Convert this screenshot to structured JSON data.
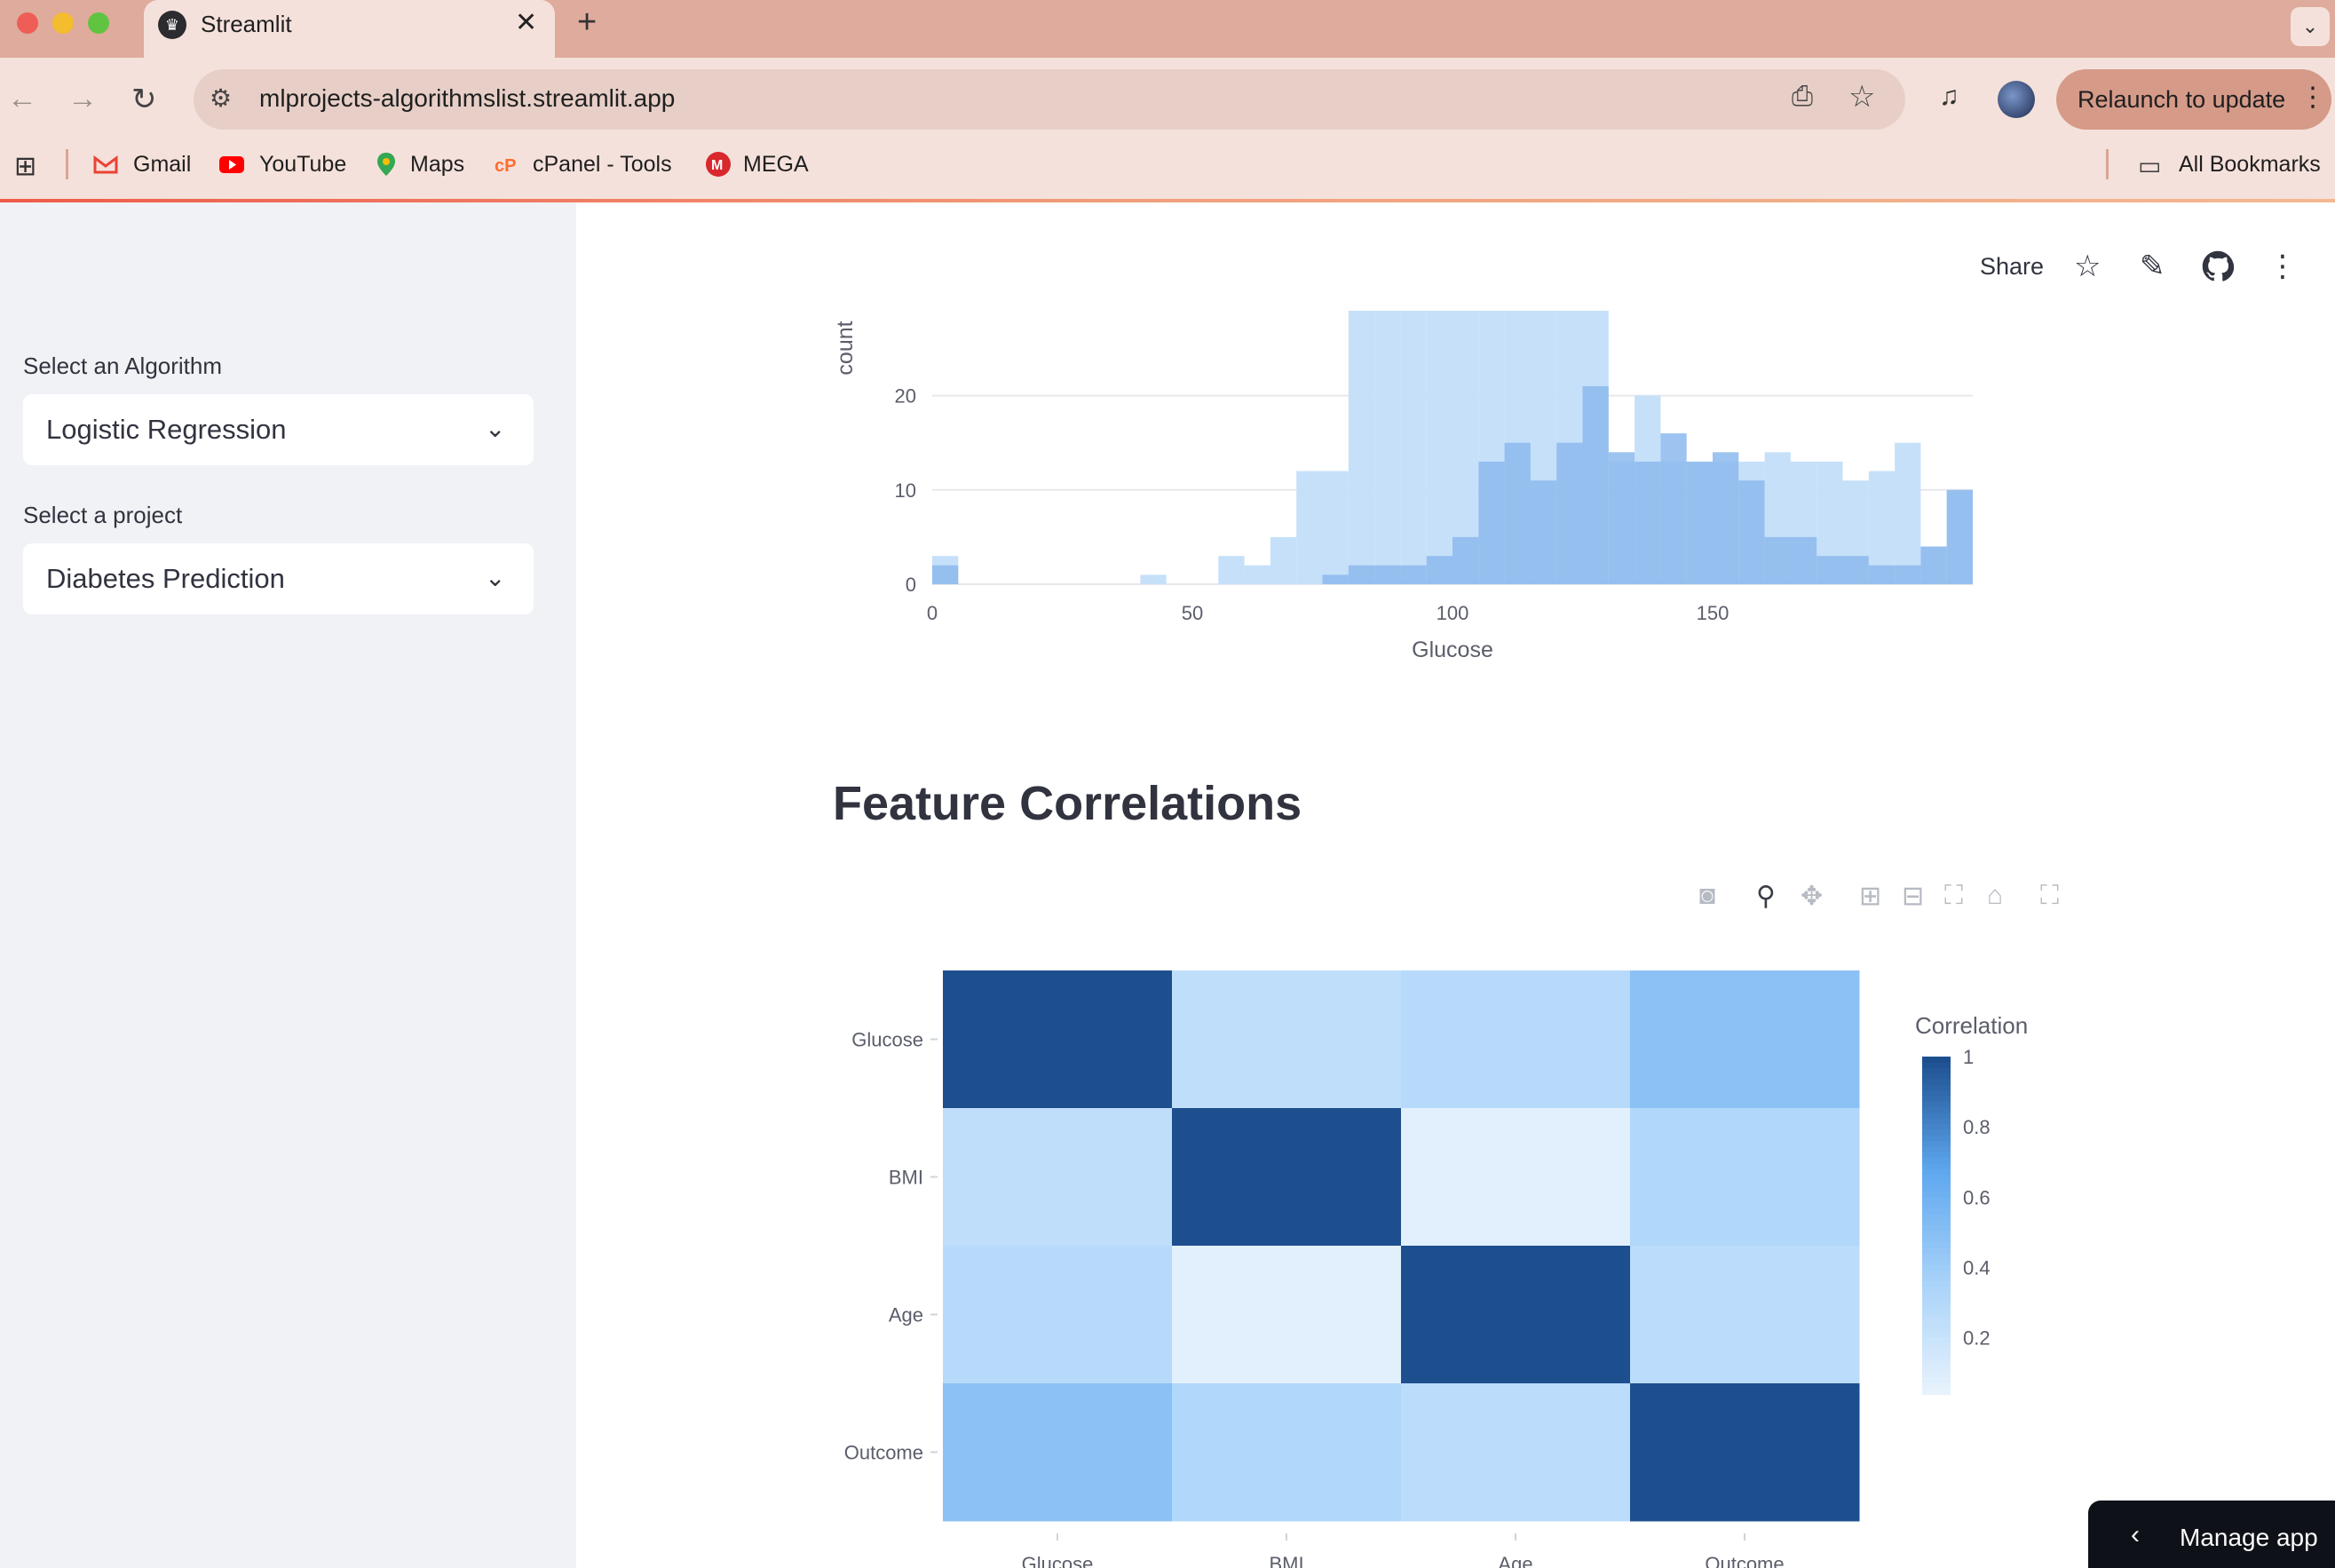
{
  "browser": {
    "tab_title": "Streamlit",
    "url": "mlprojects-algorithmslist.streamlit.app",
    "relaunch_label": "Relaunch to update",
    "bookmarks": [
      "Gmail",
      "YouTube",
      "Maps",
      "cPanel - Tools",
      "MEGA"
    ],
    "all_bookmarks": "All Bookmarks",
    "icons": {
      "back": "back-arrow-icon",
      "forward": "forward-arrow-icon",
      "reload": "reload-icon",
      "install": "install-app-icon",
      "bookmark": "star-icon",
      "media": "media-controls-icon",
      "apps": "apps-grid-icon",
      "folder": "folder-icon"
    },
    "colors": {
      "tabbar": "#dfab9c",
      "toolbar": "#f5e1db",
      "relaunch": "#d69a89"
    }
  },
  "sidebar": {
    "algorithm_label": "Select an Algorithm",
    "algorithm_value": "Logistic Regression",
    "project_label": "Select a project",
    "project_value": "Diabetes Prediction"
  },
  "header": {
    "share_label": "Share",
    "icons": [
      "star-icon",
      "edit-pencil-icon",
      "github-icon",
      "more-vertical-icon"
    ]
  },
  "section_title": "Feature Correlations",
  "manage_app_label": "Manage app",
  "modebar_icons": [
    "camera-icon",
    "zoom-icon",
    "pan-icon",
    "zoom-in-icon",
    "zoom-out-icon",
    "autoscale-icon",
    "reset-axes-icon",
    "fullscreen-icon"
  ],
  "chart_data": [
    {
      "type": "bar",
      "subtype": "overlaid-histogram",
      "xlabel": "Glucose",
      "ylabel": "count",
      "xticks": [
        "0",
        "50",
        "100",
        "150"
      ],
      "yticks": [
        "0",
        "10",
        "20"
      ],
      "xlim": [
        0,
        200
      ],
      "ylim": [
        0,
        29
      ],
      "grid": true,
      "series": [
        {
          "color": "#c6e0f9",
          "bin_width": 5,
          "x": [
            0,
            40,
            55,
            60,
            65,
            70,
            75,
            80,
            85,
            90,
            95,
            100,
            105,
            110,
            115,
            120,
            125,
            130,
            135,
            140,
            145,
            150,
            155,
            160,
            165,
            170,
            175,
            180,
            185,
            190,
            195
          ],
          "values": [
            3,
            1,
            3,
            2,
            5,
            12,
            12,
            29,
            29,
            29,
            29,
            29,
            29,
            29,
            29,
            29,
            29,
            13,
            20,
            13,
            13,
            13,
            13,
            14,
            13,
            13,
            11,
            12,
            15,
            4,
            10
          ]
        },
        {
          "color": "#8cb8ed",
          "bin_width": 5,
          "x": [
            0,
            75,
            80,
            85,
            90,
            95,
            100,
            105,
            110,
            115,
            120,
            125,
            130,
            135,
            140,
            145,
            150,
            155,
            160,
            165,
            170,
            175,
            180,
            185,
            190,
            195
          ],
          "values": [
            2,
            1,
            2,
            2,
            2,
            3,
            5,
            13,
            15,
            11,
            15,
            21,
            14,
            13,
            16,
            13,
            14,
            11,
            5,
            5,
            3,
            3,
            2,
            2,
            4,
            10
          ]
        }
      ]
    },
    {
      "type": "heatmap",
      "legend_title": "Correlation",
      "x": [
        "Glucose",
        "BMI",
        "Age",
        "Outcome"
      ],
      "y": [
        "Glucose",
        "BMI",
        "Age",
        "Outcome"
      ],
      "z": [
        [
          1,
          0.22,
          0.26,
          0.47
        ],
        [
          0.22,
          1,
          0.04,
          0.29
        ],
        [
          0.26,
          0.04,
          1,
          0.24
        ],
        [
          0.47,
          0.29,
          0.24,
          1
        ]
      ],
      "colorbar_ticks": [
        "0.2",
        "0.4",
        "0.6",
        "0.8",
        "1"
      ],
      "colorscale": [
        "#eaf4fd",
        "#a9d3f9",
        "#5fa8ef",
        "#1d4f8f"
      ]
    }
  ]
}
